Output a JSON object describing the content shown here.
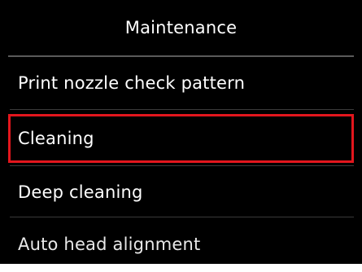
{
  "screen": {
    "title": "Maintenance",
    "items": [
      {
        "label": "Print nozzle check pattern"
      },
      {
        "label": "Cleaning"
      },
      {
        "label": "Deep cleaning"
      },
      {
        "label": "Auto head alignment"
      }
    ],
    "selected_index": 1,
    "colors": {
      "background": "#000000",
      "text": "#ffffff",
      "selection_border": "#e3161d",
      "divider": "#5a5a5a"
    }
  }
}
